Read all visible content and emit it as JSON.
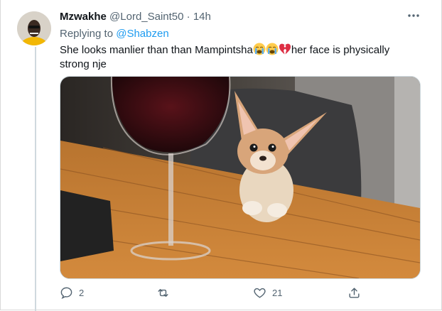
{
  "tweet": {
    "display_name": "Mzwakhe",
    "handle": "@Lord_Saint50",
    "separator": "·",
    "time": "14h",
    "reply_prefix": "Replying to ",
    "reply_to": "@Shabzen",
    "text_before": "She looks manlier than than Mampintsha",
    "emojis": [
      "loudly-crying-face",
      "loudly-crying-face",
      "broken-heart"
    ],
    "text_after": "her face is physically strong nje",
    "media_description_icons": [
      "wine-glass",
      "chihuahua",
      "table",
      "chair"
    ]
  },
  "actions": {
    "reply_count": "2",
    "retweet_count": "",
    "like_count": "21",
    "share_count": ""
  },
  "icons": {
    "more": "more-icon",
    "reply": "reply-icon",
    "retweet": "retweet-icon",
    "like": "heart-icon",
    "share": "share-icon"
  },
  "colors": {
    "link": "#1d9bf0",
    "muted": "#536471",
    "text": "#0f1419"
  }
}
